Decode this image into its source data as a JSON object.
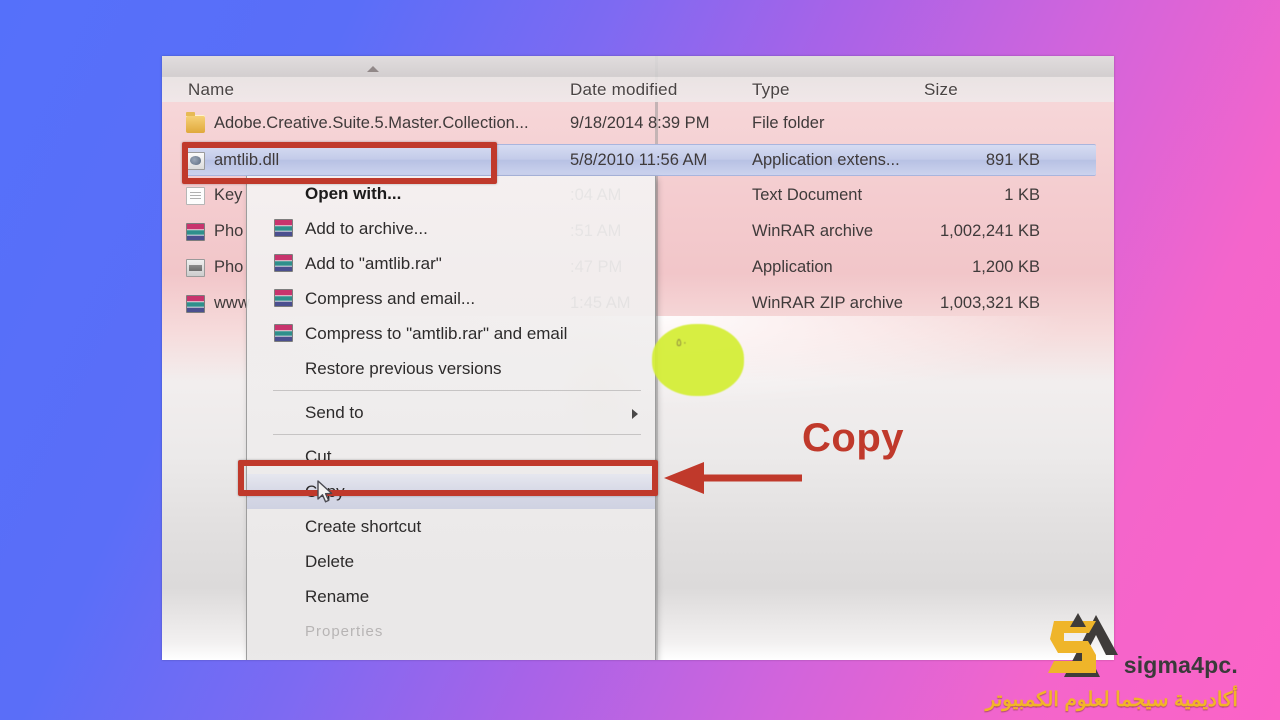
{
  "explorer": {
    "columns": [
      "Name",
      "Date modified",
      "Type",
      "Size"
    ],
    "rows": [
      {
        "icon": "folder-icon",
        "name": "Adobe.Creative.Suite.5.Master.Collection...",
        "date": "9/18/2014 8:39 PM",
        "type": "File folder",
        "size": ""
      },
      {
        "icon": "dll-icon",
        "name": "amtlib.dll",
        "date": "5/8/2010 11:56 AM",
        "type": "Application extens...",
        "size": "891 KB",
        "selected": true
      },
      {
        "icon": "text-file-icon",
        "name": "Key",
        "date": ":04 AM",
        "type": "Text Document",
        "size": "1 KB"
      },
      {
        "icon": "winrar-icon",
        "name": "Pho",
        "date": ":51 AM",
        "type": "WinRAR archive",
        "size": "1,002,241 KB"
      },
      {
        "icon": "application-icon",
        "name": "Pho",
        "date": ":47 PM",
        "type": "Application",
        "size": "1,200 KB"
      },
      {
        "icon": "winrar-icon",
        "name": "www",
        "date": "1:45 AM",
        "type": "WinRAR ZIP archive",
        "size": "1,003,321 KB"
      }
    ]
  },
  "context_menu": {
    "items": [
      {
        "label": "Open with...",
        "icon": "",
        "bold": true
      },
      {
        "label": "Add to archive...",
        "icon": "winrar-icon"
      },
      {
        "label": "Add to \"amtlib.rar\"",
        "icon": "winrar-icon"
      },
      {
        "label": "Compress and email...",
        "icon": "winrar-icon"
      },
      {
        "label": "Compress to \"amtlib.rar\" and email",
        "icon": "winrar-icon"
      },
      {
        "label": "Restore previous versions",
        "icon": ""
      },
      {
        "separator": true
      },
      {
        "label": "Send to",
        "icon": "",
        "submenu": true
      },
      {
        "separator": true
      },
      {
        "label": "Cut",
        "icon": ""
      },
      {
        "label": "Copy",
        "icon": "",
        "highlighted": true
      },
      {
        "label": "Create shortcut",
        "icon": ""
      },
      {
        "label": "Delete",
        "icon": ""
      },
      {
        "label": "Rename",
        "icon": ""
      },
      {
        "label": "Properties",
        "icon": "",
        "faded": true
      }
    ]
  },
  "annotations": {
    "callout_text": "Copy",
    "accent_color": "#c0392b",
    "highlight_color": "#d4ee33",
    "highlight_note": "٥٠"
  },
  "watermark": {
    "brand": "sigma4pc.",
    "arabic": "أكاديمية سيجما لعلوم الكمبيوتر",
    "logo_gold": "#efb52a",
    "logo_dark": "#3f3c3a"
  }
}
